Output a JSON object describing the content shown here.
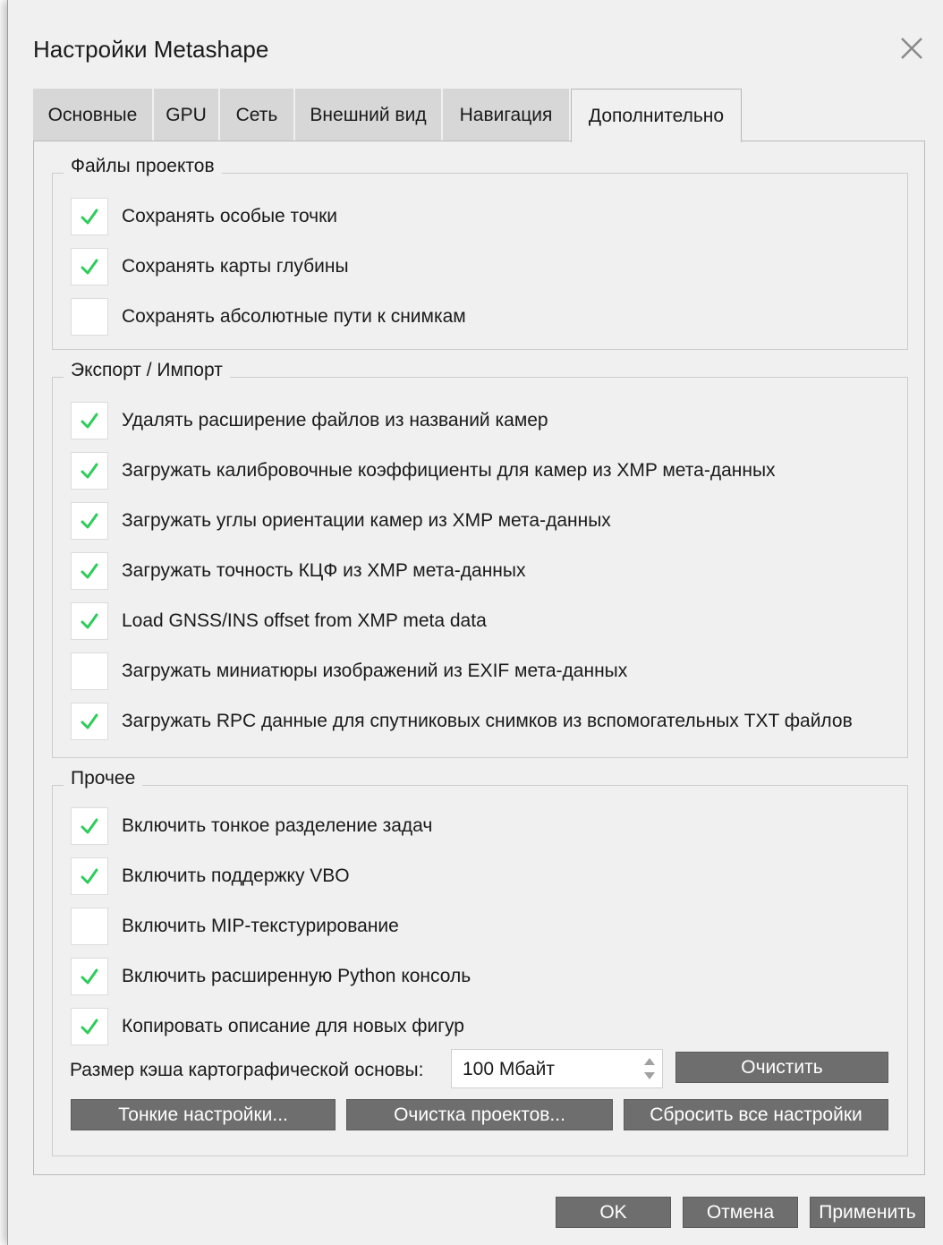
{
  "window": {
    "title": "Настройки Metashape"
  },
  "tabs": [
    {
      "label": "Основные"
    },
    {
      "label": "GPU"
    },
    {
      "label": "Сеть"
    },
    {
      "label": "Внешний вид"
    },
    {
      "label": "Навигация"
    },
    {
      "label": "Дополнительно",
      "active": true
    }
  ],
  "project_files": {
    "title": "Файлы проектов",
    "items": [
      {
        "label": "Сохранять особые точки",
        "checked": true
      },
      {
        "label": "Сохранять карты глубины",
        "checked": true
      },
      {
        "label": "Сохранять абсолютные пути к снимкам",
        "checked": false
      }
    ]
  },
  "export_import": {
    "title": "Экспорт / Импорт",
    "items": [
      {
        "label": "Удалять расширение файлов из названий камер",
        "checked": true
      },
      {
        "label": "Загружать калибровочные коэффициенты для камер из XMP мета-данных",
        "checked": true
      },
      {
        "label": "Загружать углы ориентации камер из XMP мета-данных",
        "checked": true
      },
      {
        "label": "Загружать точность КЦФ из XMP мета-данных",
        "checked": true
      },
      {
        "label": "Load GNSS/INS offset from XMP meta data",
        "checked": true
      },
      {
        "label": "Загружать миниатюры изображений из EXIF мета-данных",
        "checked": false
      },
      {
        "label": "Загружать RPC данные для спутниковых снимков из вспомогательных TXT файлов",
        "checked": true
      }
    ]
  },
  "other": {
    "title": "Прочее",
    "items": [
      {
        "label": "Включить тонкое разделение задач",
        "checked": true
      },
      {
        "label": "Включить поддержку VBO",
        "checked": true
      },
      {
        "label": "Включить MIP-текстурирование",
        "checked": false
      },
      {
        "label": "Включить расширенную Python консоль",
        "checked": true
      },
      {
        "label": "Копировать описание для новых фигур",
        "checked": true
      }
    ],
    "cache_label": "Размер кэша картографической основы:",
    "cache_value": "100 Мбайт",
    "clear_button": "Очистить",
    "fine_settings_button": "Тонкие настройки...",
    "clean_projects_button": "Очистка проектов...",
    "reset_all_button": "Сбросить все настройки"
  },
  "footer": {
    "ok": "OK",
    "cancel": "Отмена",
    "apply": "Применить"
  },
  "colors": {
    "check": "#2ecc5a",
    "button_bg": "#6e6e6e"
  },
  "icons": {
    "close": "close-icon",
    "check": "checkmark-icon"
  }
}
